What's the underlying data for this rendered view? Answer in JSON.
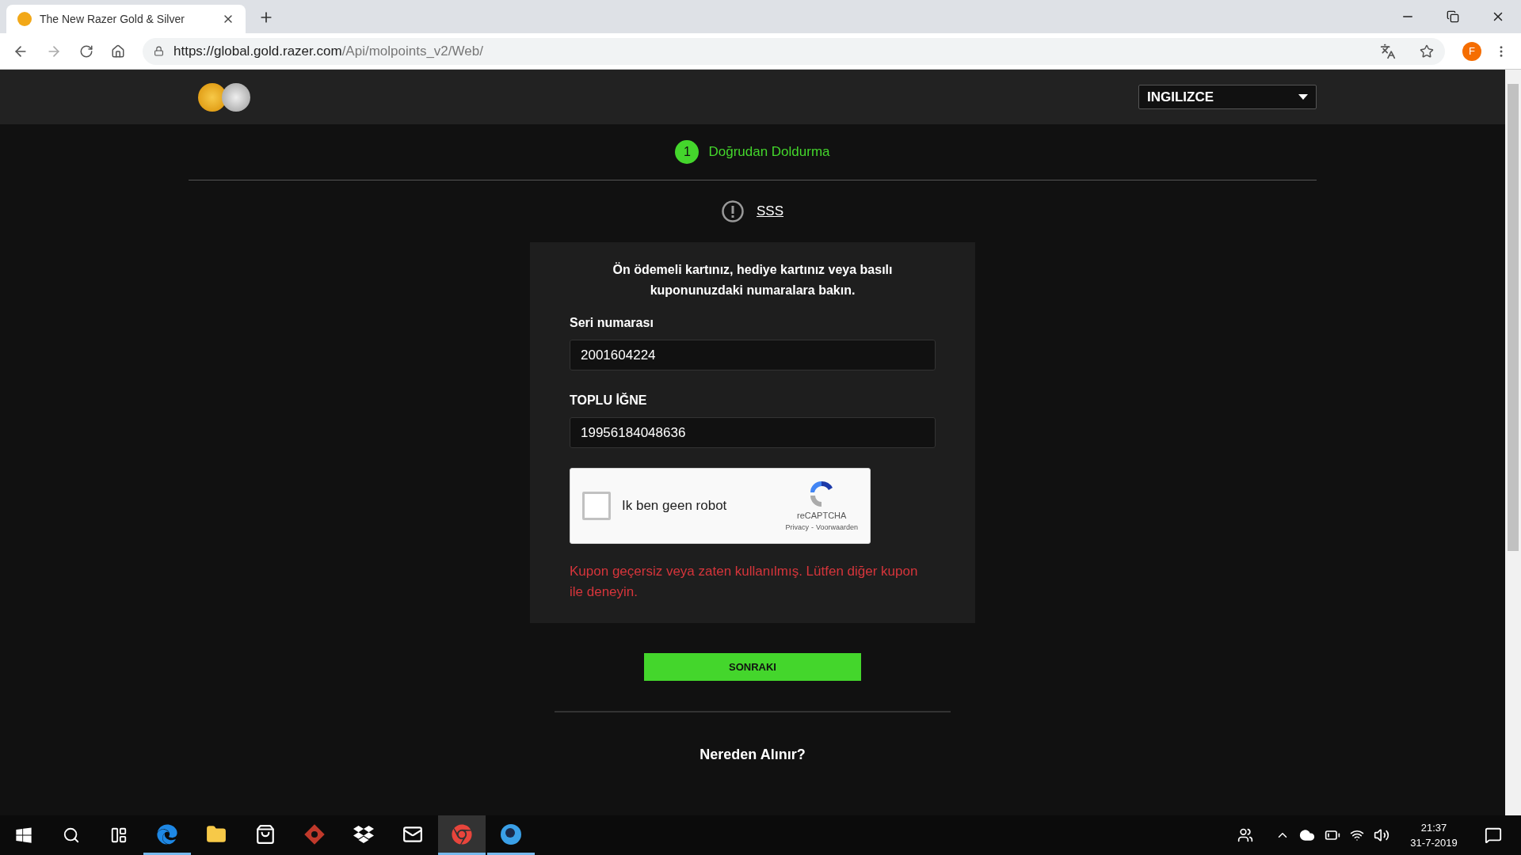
{
  "browser": {
    "tab_title": "The New Razer Gold & Silver",
    "url_host": "https://global.gold.razer.com",
    "url_path": "/Api/molpoints_v2/Web/",
    "profile_initial": "F"
  },
  "header": {
    "language": "INGILIZCE"
  },
  "steps": [
    {
      "number": "1",
      "label": "Doğrudan Doldurma",
      "selected": true
    }
  ],
  "faq": "SSS",
  "card": {
    "instruction": "Ön ödemeli kartınız, hediye kartınız veya basılı kuponunuzdaki numaralara bakın.",
    "fields": [
      {
        "label": "Seri numarası",
        "value": "2001604224"
      },
      {
        "label": "TOPLU İĞNE",
        "value": "19956184048636"
      }
    ],
    "captcha": {
      "label": "Ik ben geen robot",
      "checked": false,
      "brand": "reCAPTCHA",
      "links": [
        "Privacy",
        "Voorwaarden"
      ],
      "link_separator": "-"
    },
    "error": "Kupon geçersiz veya zaten kullanılmış. Lütfen diğer kupon ile deneyin."
  },
  "next_button": "SONRAKI",
  "where_to_buy": "Nereden Alınır?",
  "taskbar": {
    "apps": [
      {
        "kind": "edge",
        "open": true,
        "active": false
      },
      {
        "kind": "explorer",
        "open": false,
        "active": false
      },
      {
        "kind": "store",
        "open": false,
        "active": false
      },
      {
        "kind": "game",
        "open": false,
        "active": false
      },
      {
        "kind": "dropbox",
        "open": false,
        "active": false
      },
      {
        "kind": "mail",
        "open": false,
        "active": false
      },
      {
        "kind": "chrome",
        "open": true,
        "active": true
      },
      {
        "kind": "orb",
        "open": true,
        "active": false
      }
    ],
    "time": "21:37",
    "date": "31-7-2019"
  }
}
